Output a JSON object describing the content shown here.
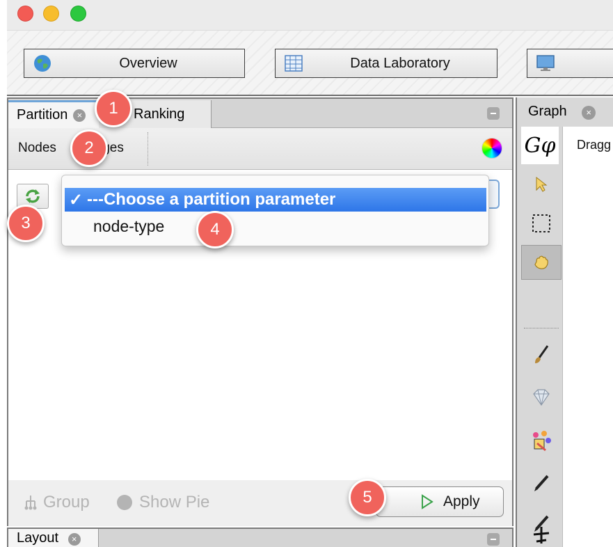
{
  "toolbar": {
    "overview_label": "Overview",
    "datalab_label": "Data Laboratory",
    "preview_label": ""
  },
  "partition_panel": {
    "tabs": [
      {
        "label": "Partition",
        "close": "×"
      },
      {
        "label": "Ranking"
      }
    ],
    "subtabs": {
      "nodes": "Nodes",
      "edges": "Edges"
    },
    "dropdown": {
      "check": "✓",
      "options": [
        "---Choose a partition parameter",
        "node-type"
      ],
      "selected_index": 0
    },
    "group_label": "Group",
    "show_pie_label": "Show Pie",
    "apply_label": "Apply"
  },
  "layout_panel": {
    "tab_label": "Layout",
    "close": "×"
  },
  "graph_panel": {
    "tab_label": "Graph",
    "close": "×",
    "logo_text": "Gφ",
    "drag_text": "Dragg",
    "tools": [
      "pointer-icon",
      "rect-select-icon",
      "hand-drag-icon",
      "brush-icon",
      "diamond-icon",
      "painter-icon",
      "pencil-icon",
      "pencil-icon",
      "airplane-icon"
    ]
  },
  "callouts": [
    "1",
    "2",
    "3",
    "4",
    "5"
  ],
  "colors": {
    "accent": "#2e76e8",
    "callout": "#f0635c"
  }
}
